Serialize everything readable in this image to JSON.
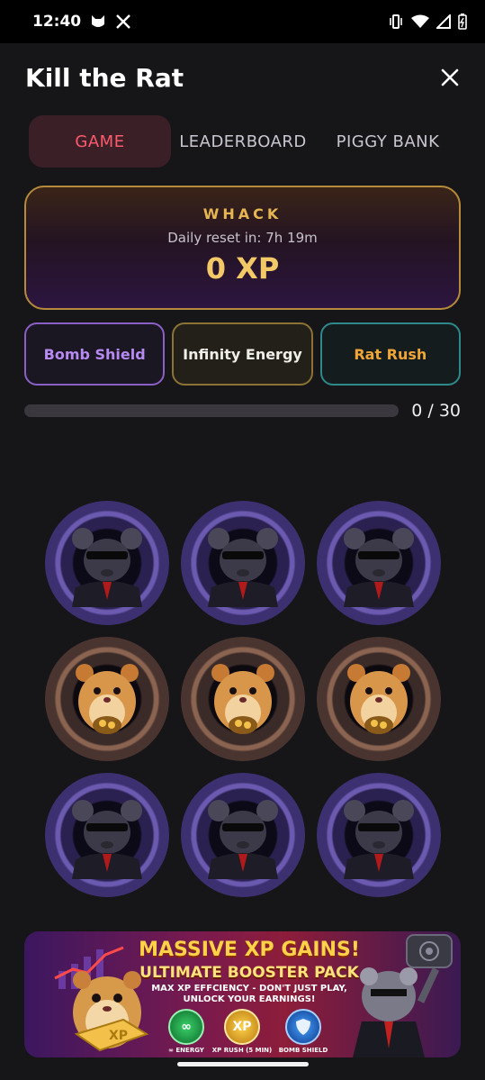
{
  "status": {
    "time": "12:40"
  },
  "header": {
    "title": "Kill the Rat"
  },
  "tabs": [
    {
      "label": "GAME",
      "active": true
    },
    {
      "label": "LEADERBOARD",
      "active": false
    },
    {
      "label": "PIGGY BANK",
      "active": false
    }
  ],
  "xp_card": {
    "label": "WHACK",
    "reset": "Daily reset in: 7h 19m",
    "xp": "0 XP"
  },
  "boosters": [
    {
      "label": "Bomb Shield",
      "color": "#b68af0"
    },
    {
      "label": "Infinity Energy",
      "color": "#f0eee8"
    },
    {
      "label": "Rat Rush",
      "color": "#f0a636"
    }
  ],
  "progress": {
    "text": "0 / 30",
    "fraction": 0
  },
  "grid": {
    "holes": [
      {
        "type": "rat"
      },
      {
        "type": "rat"
      },
      {
        "type": "rat"
      },
      {
        "type": "hamster"
      },
      {
        "type": "hamster"
      },
      {
        "type": "hamster"
      },
      {
        "type": "rat"
      },
      {
        "type": "rat"
      },
      {
        "type": "rat"
      }
    ]
  },
  "banner": {
    "headline": "MASSIVE XP GAINS!",
    "subheadline": "ULTIMATE BOOSTER PACK",
    "tagline_1": "MAX XP EFFCIENCY - DON'T JUST PLAY,",
    "tagline_2": "UNLOCK YOUR EARNINGS!",
    "chips": [
      {
        "label": "∞ ENERGY",
        "icon": "infinity-icon"
      },
      {
        "label": "XP RUSH (5 MIN)",
        "icon": "xp-coin-icon"
      },
      {
        "label": "BOMB SHIELD",
        "icon": "shield-icon"
      }
    ]
  }
}
